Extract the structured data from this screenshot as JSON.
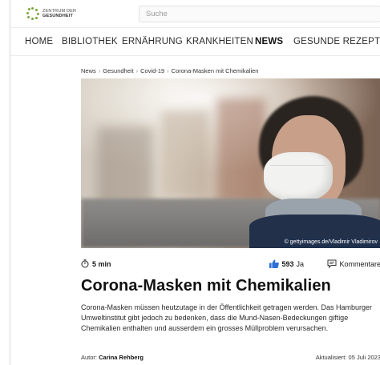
{
  "logo": {
    "line1": "ZENTRUM DER",
    "line2": "GESUNDHEIT"
  },
  "search": {
    "placeholder": "Suche"
  },
  "nav": {
    "items": [
      "HOME",
      "BIBLIOTHEK",
      "ERNÄHRUNG",
      "KRANKHEITEN",
      "NEWS",
      "GESUNDE REZEPTE"
    ],
    "active": "NEWS"
  },
  "breadcrumb": [
    "News",
    "Gesundheit",
    "Covid-19",
    "Corona-Masken mit Chemikalien"
  ],
  "image": {
    "credit": "© gettyimages.de/Vladimir Vladimirov"
  },
  "meta": {
    "read_time": "5 min",
    "likes_count": "593",
    "likes_label": "Ja",
    "comments_label": "Kommentare"
  },
  "article": {
    "title": "Corona-Masken mit Chemikalien",
    "lead": "Corona-Masken müssen heutzutage in der Öffentlichkeit getragen werden. Das Hamburger Umweltinstitut gibt jedoch zu bedenken, dass die Mund-Nasen-Bedeckungen giftige Chemikalien enthalten und ausserdem ein grosses Müllproblem verursachen.",
    "author_label": "Autor:",
    "author_name": "Carina Rehberg",
    "updated": "Aktualisiert: 05 Juli 2023"
  },
  "colors": {
    "accent": "#7aa640",
    "like": "#2f6fd6"
  },
  "icons": [
    "logo-icon",
    "timer-icon",
    "thumbs-up-icon",
    "comment-icon"
  ]
}
